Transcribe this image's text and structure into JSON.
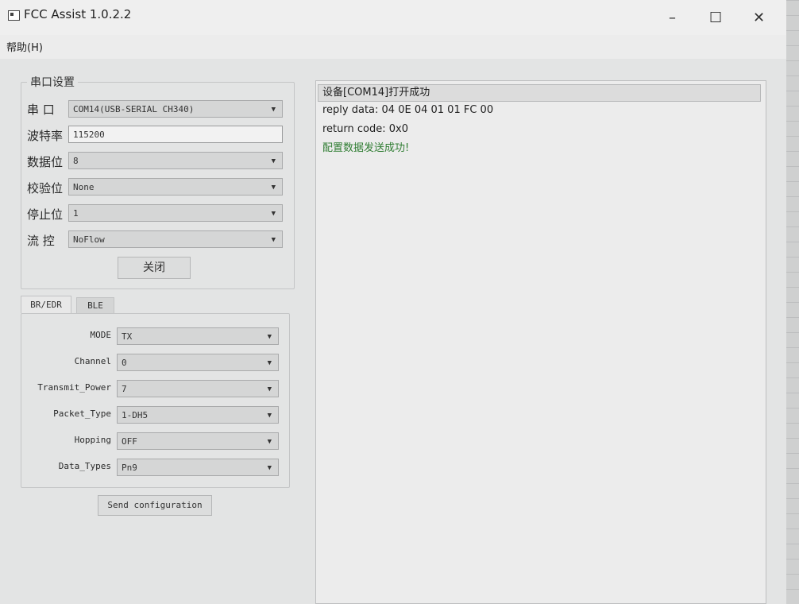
{
  "window": {
    "title": "FCC Assist 1.0.2.2",
    "min": "–",
    "max": "☐",
    "close": "✕"
  },
  "menu": {
    "help": "帮助(H)"
  },
  "serial": {
    "group_title": "串口设置",
    "port_label": "串  口",
    "port_value": "COM14(USB-SERIAL CH340)",
    "baud_label": "波特率",
    "baud_value": "115200",
    "databits_label": "数据位",
    "databits_value": "8",
    "parity_label": "校验位",
    "parity_value": "None",
    "stopbits_label": "停止位",
    "stopbits_value": "1",
    "flow_label": "流  控",
    "flow_value": "NoFlow",
    "close_button": "关闭"
  },
  "tabs": [
    {
      "label": "BR/EDR",
      "active": true
    },
    {
      "label": "BLE",
      "active": false
    }
  ],
  "params": [
    {
      "label": "MODE",
      "value": "TX"
    },
    {
      "label": "Channel",
      "value": "0"
    },
    {
      "label": "Transmit_Power",
      "value": "7"
    },
    {
      "label": "Packet_Type",
      "value": "1-DH5"
    },
    {
      "label": "Hopping",
      "value": "OFF"
    },
    {
      "label": "Data_Types",
      "value": "Pn9"
    }
  ],
  "send_button": "Send configuration",
  "log": {
    "lines": [
      "设备[COM14]打开成功",
      "reply data: 04 0E 04 01 01 FC 00",
      "return code: 0x0",
      "配置数据发送成功!"
    ],
    "success_color": "#2f7d32"
  },
  "icons": {
    "dropdown": "▼"
  }
}
